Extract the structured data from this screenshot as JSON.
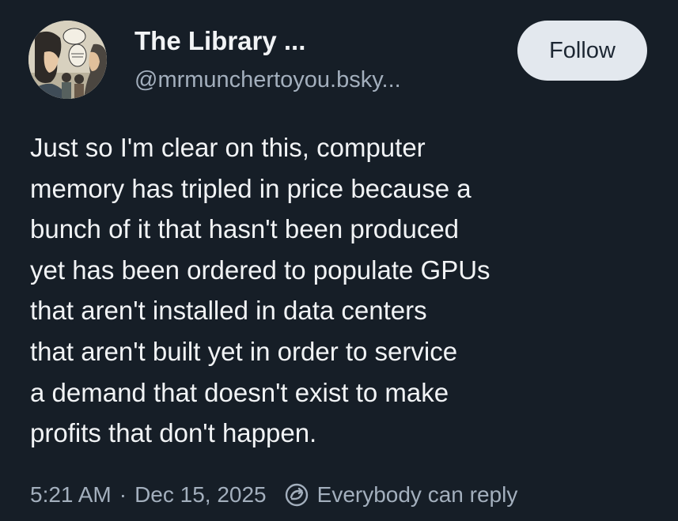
{
  "post": {
    "author": {
      "display_name": "The Library ...",
      "handle": "@mrmunchertoyou.bsky..."
    },
    "follow_label": "Follow",
    "text_lines": [
      "Just so I'm clear on this, computer",
      "memory has tripled in price because a",
      "bunch of it that hasn't been produced",
      "yet has been ordered to populate GPUs",
      "that aren't installed in data centers",
      "that aren't built yet in order to service",
      "a demand that doesn't exist to make",
      "profits that don't happen."
    ],
    "meta": {
      "time": "5:21 AM",
      "separator": "·",
      "date": "Dec 15, 2025",
      "reply_setting": "Everybody can reply"
    }
  },
  "icons": {
    "avatar": "comic-illustration-avatar",
    "reply_setting": "reply-setting-icon"
  },
  "colors": {
    "background": "#161e27",
    "text": "#f1f3f5",
    "muted_text": "#a3afbd",
    "follow_button_bg": "#e3e8ee",
    "follow_button_text": "#1d2733"
  }
}
